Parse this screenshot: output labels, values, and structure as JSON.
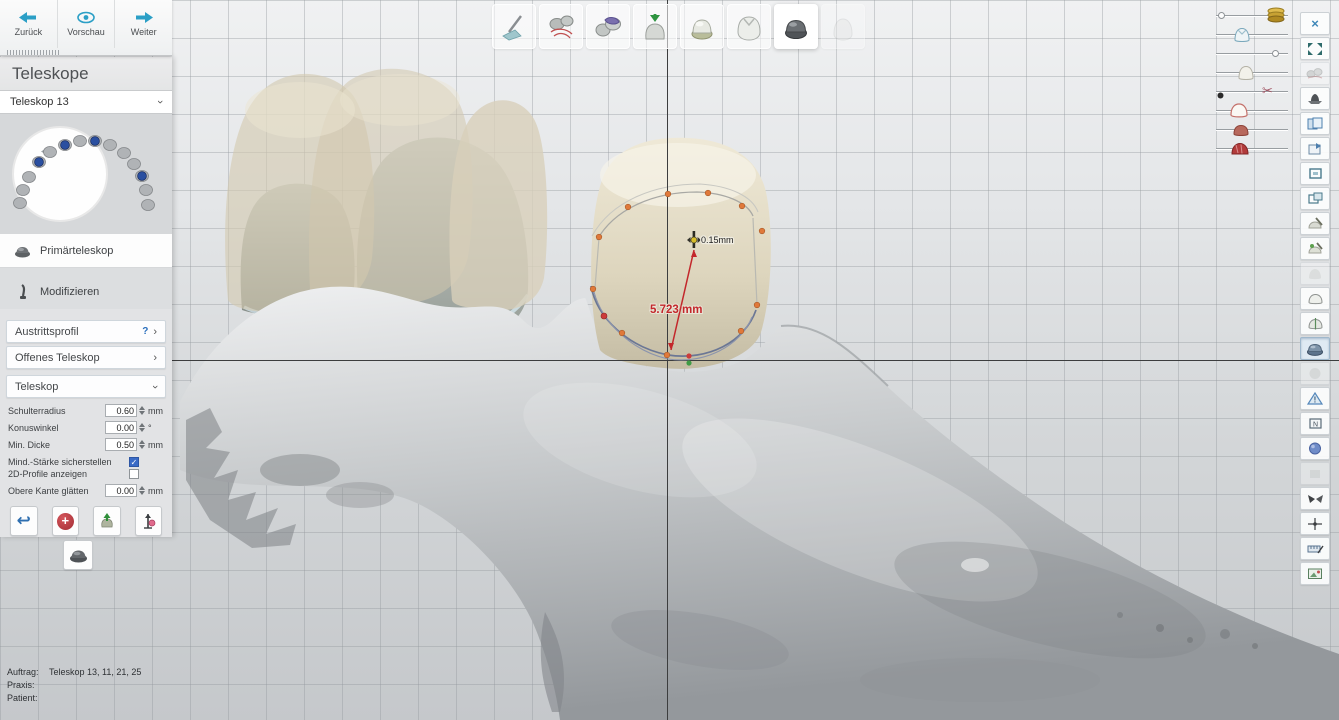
{
  "nav": {
    "back_label": "Zurück",
    "preview_label": "Vorschau",
    "next_label": "Weiter"
  },
  "sidebar": {
    "title": "Teleskope",
    "tooth_selector": "Teleskop 13",
    "steps": [
      {
        "label": "Primärteleskop",
        "icon": "primary-telescope-icon",
        "active": true
      },
      {
        "label": "Modifizieren",
        "icon": "modify-icon",
        "active": false
      }
    ],
    "sections": [
      {
        "label": "Austrittsprofil",
        "help": "?",
        "state": "collapsed"
      },
      {
        "label": "Offenes Teleskop",
        "state": "collapsed"
      },
      {
        "label": "Teleskop",
        "state": "expanded"
      }
    ],
    "params": [
      {
        "label": "Schulterradius",
        "value": "0.60",
        "unit": "mm"
      },
      {
        "label": "Konuswinkel",
        "value": "0.00",
        "unit": "°"
      },
      {
        "label": "Min. Dicke",
        "value": "0.50",
        "unit": "mm"
      }
    ],
    "checks": [
      {
        "label": "Mind.-Stärke sicherstellen",
        "checked": true
      },
      {
        "label": "2D-Profile anzeigen",
        "checked": false
      }
    ],
    "smooth_param": {
      "label": "Obere Kante glätten",
      "value": "0.00",
      "unit": "mm"
    },
    "tool_icons": [
      "undo-icon",
      "add-material-icon",
      "insertion-axis-icon",
      "measure-icon",
      "primary-crown-icon"
    ]
  },
  "workflow": {
    "steps": [
      {
        "icon": "scan-probe-icon"
      },
      {
        "icon": "segmentation-icon"
      },
      {
        "icon": "blockout-icon"
      },
      {
        "icon": "insertion-direction-icon"
      },
      {
        "icon": "cap-base-icon"
      },
      {
        "icon": "anatomic-crown-icon"
      },
      {
        "icon": "telescope-icon",
        "active": true
      },
      {
        "icon": "final-tooth-icon",
        "disabled": true
      }
    ]
  },
  "view_sliders": {
    "items": [
      {
        "icon": "layer-stack-icon"
      },
      {
        "icon": "primary-crown-blue-icon"
      },
      {
        "icon": "plain-handle-icon"
      },
      {
        "icon": "tooth-white-icon"
      },
      {
        "icon": "scissors-icon"
      },
      {
        "icon": "tooth-outline-red-icon"
      },
      {
        "icon": "prep-tooth-red-icon"
      },
      {
        "icon": "gingiva-dome-icon"
      }
    ]
  },
  "right_toolbar": {
    "items": [
      {
        "name": "rotate-view-icon"
      },
      {
        "name": "zoom-fit-icon"
      },
      {
        "name": "show-scan-icon",
        "disabled": true
      },
      {
        "name": "model-base-icon"
      },
      {
        "name": "split-view-icon"
      },
      {
        "name": "export-view-icon"
      },
      {
        "name": "clip-frame-icon"
      },
      {
        "name": "clip-frame-2-icon"
      },
      {
        "name": "wax-add-icon"
      },
      {
        "name": "wax-smooth-icon"
      },
      {
        "name": "ghost-tooth-icon",
        "disabled": true
      },
      {
        "name": "tooth-outline-icon"
      },
      {
        "name": "tooth-section-icon"
      },
      {
        "name": "telescope-view-icon",
        "active": true
      },
      {
        "name": "ghost-sphere-icon",
        "disabled": true
      },
      {
        "name": "collision-warning-icon"
      },
      {
        "name": "grid-box-icon"
      },
      {
        "name": "paint-sphere-icon"
      },
      {
        "name": "ghost-box-icon",
        "disabled": true
      },
      {
        "name": "mirror-wings-icon"
      },
      {
        "name": "axis-cross-icon"
      },
      {
        "name": "measure-ruler-icon"
      },
      {
        "name": "snapshot-icon"
      }
    ]
  },
  "canvas": {
    "measurements": {
      "thickness": "0.15mm",
      "distance": "5.723 mm"
    },
    "accent_colors": {
      "measure_red": "#c3272b",
      "control_point_orange": "#e0793a",
      "margin_blue": "#6b7795",
      "selection_blue": "#2a4fa0"
    }
  },
  "status": {
    "order_label": "Auftrag:",
    "order_value": "Teleskop 13, 11, 21, 25",
    "practice_label": "Praxis:",
    "practice_value": "",
    "patient_label": "Patient:",
    "patient_value": ""
  }
}
